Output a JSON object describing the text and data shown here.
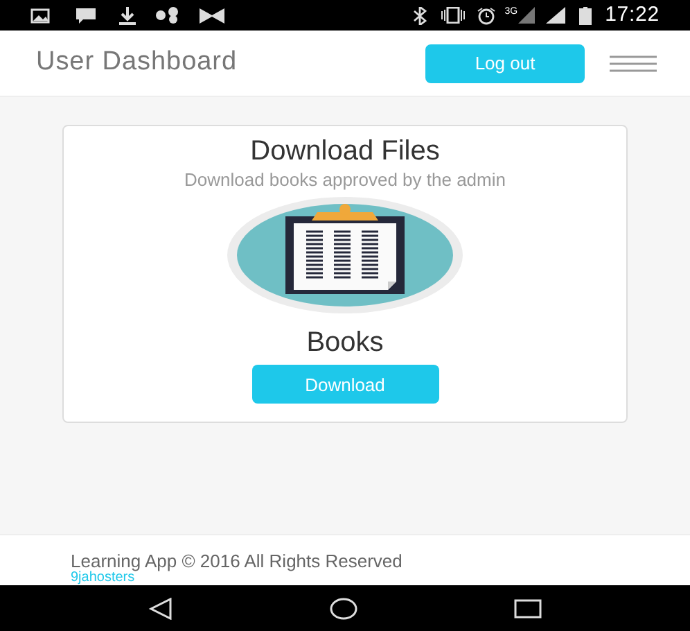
{
  "status_bar": {
    "network": "3G",
    "time": "17:22"
  },
  "header": {
    "title": "User Dashboard",
    "logout_button": "Log out"
  },
  "card": {
    "title": "Download Files",
    "subtitle": "Download books approved by the admin",
    "item_title": "Books",
    "download_button": "Download"
  },
  "footer": {
    "text": "Learning App © 2016 All Rights Reserved",
    "link": "9jahosters"
  }
}
